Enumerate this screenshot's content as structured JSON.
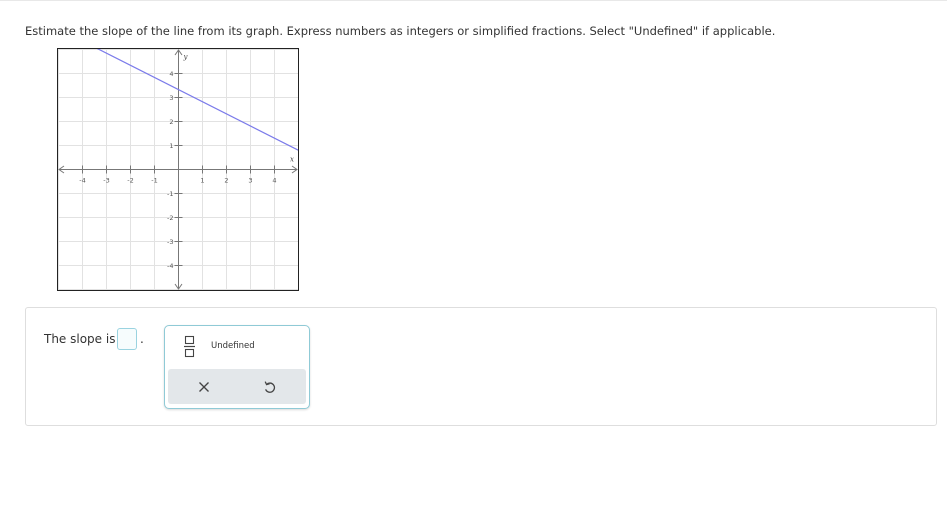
{
  "instructions": "Estimate the slope of the line from its graph. Express numbers as integers or simplified fractions. Select \"Undefined\" if applicable.",
  "graph": {
    "x_axis_label": "x",
    "y_axis_label": "y",
    "x_tick_labels": [
      "-4",
      "-3",
      "-2",
      "-1",
      "1",
      "2",
      "3",
      "4"
    ],
    "y_tick_labels": [
      "4",
      "3",
      "2",
      "1",
      "-1",
      "-2",
      "-3",
      "-4"
    ],
    "line_color": "#7b7bea",
    "line_points": [
      [
        -3.7,
        5.2
      ],
      [
        5,
        0.8
      ]
    ]
  },
  "answer": {
    "slope_label": "The slope is",
    "input_value": "",
    "period": "."
  },
  "palette": {
    "fraction_icon": "fraction-icon",
    "undefined_label": "Undefined",
    "clear_icon": "times-icon",
    "undo_icon": "undo-icon"
  },
  "colors": {
    "accent": "#8fcad6",
    "input_border": "#9ad3e0",
    "toolbar_bg": "#e3e7ea",
    "grid": "#e2e2e2",
    "axis": "#777777"
  }
}
